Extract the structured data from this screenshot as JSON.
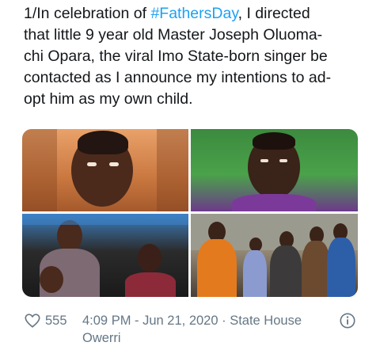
{
  "tweet": {
    "lines": [
      {
        "before": "1/In celebration of ",
        "hashtag": "#FathersDay",
        "after": ", I directed"
      },
      {
        "text": "that little 9 year old Master Joseph Oluoma-"
      },
      {
        "text": "chi Opara, the viral Imo State-born singer be"
      },
      {
        "text": "contacted as I announce my intentions to ad-"
      },
      {
        "text": "opt him as my own child."
      }
    ]
  },
  "media": {
    "images": [
      {
        "name": "boy-closeup-photo"
      },
      {
        "name": "boy-portrait-photo"
      },
      {
        "name": "family-photo"
      },
      {
        "name": "handover-group-photo"
      }
    ]
  },
  "footer": {
    "likes": "555",
    "timestamp": "4:09 PM - Jun 21, 2020 · State House",
    "location_cont": "Owerri",
    "heart_icon": "heart-outline-icon",
    "info_icon": "info-circle-icon"
  },
  "colors": {
    "text": "#14171a",
    "link": "#1da1f2",
    "muted": "#657786"
  }
}
